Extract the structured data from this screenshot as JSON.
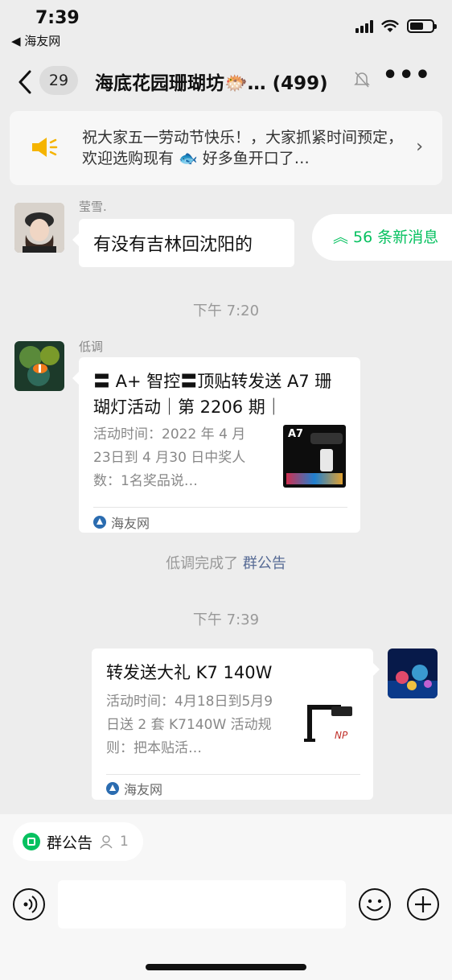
{
  "status_bar": {
    "time": "7:39",
    "back_app": "◀ 海友网"
  },
  "nav": {
    "back_icon": "chevron-left-icon",
    "unread_count": "29",
    "title": "海底花园珊瑚坊🐡… (499)",
    "mute_icon": "bell-mute-icon",
    "more_icon": "more-icon"
  },
  "notice": {
    "icon": "megaphone-icon",
    "text": "祝大家五一劳动节快乐！，大家抓紧时间预定，欢迎选购现有 🐟 好多鱼开口了…"
  },
  "new_messages": {
    "label": "56 条新消息"
  },
  "messages": [
    {
      "sender": "莹雪.",
      "text": "有没有吉林回沈阳的"
    }
  ],
  "timestamps": {
    "t1": "下午 7:20",
    "t2": "下午 7:39"
  },
  "card1": {
    "sender": "低调",
    "title": "〓 A+ 智控〓顶贴转发送 A7 珊 瑚灯活动｜第 2206 期｜",
    "description": "活动时间：2022 年 4 月23日到 4 月30 日中奖人数：1名奖品说…",
    "thumb_label": "A7",
    "source": "海友网"
  },
  "system": {
    "prefix": "低调完成了",
    "link": "群公告"
  },
  "card2": {
    "title": "转发送大礼 K7 140W",
    "description": "活动时间：4月18日到5月9日送 2 套 K7140W 活动规则：把本贴活…",
    "source": "海友网"
  },
  "bottom": {
    "chip_label": "群公告",
    "chip_count": "1",
    "voice_icon": "voice-icon",
    "emoji_icon": "emoji-icon",
    "plus_icon": "plus-icon"
  },
  "colors": {
    "background": "#ededed",
    "accent_green": "#07c160",
    "link_blue": "#576b95"
  }
}
